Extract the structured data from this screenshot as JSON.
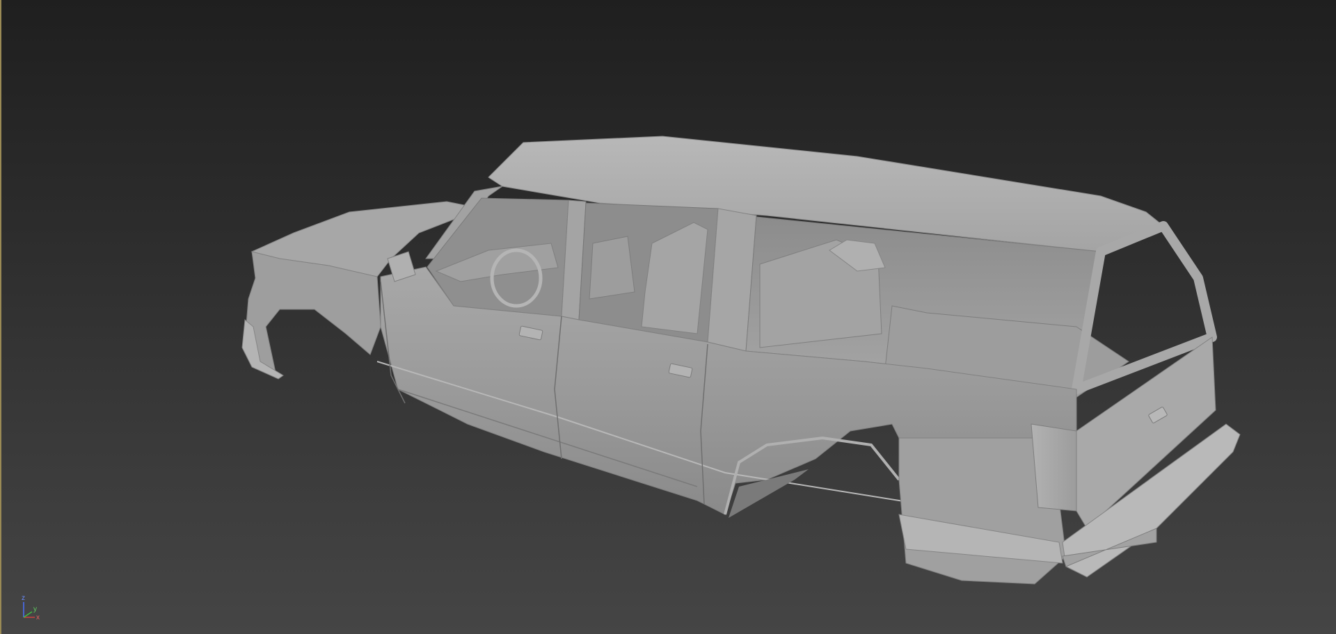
{
  "viewport": {
    "name": "3d-viewport-perspective",
    "background_top": "#1f1f1f",
    "background_bottom": "#454545",
    "border_color": "#9a8a55"
  },
  "model": {
    "shading_color": "#a9a9a9",
    "name": "suv-body-shell-model"
  },
  "axis_gizmo": {
    "x_label": "x",
    "y_label": "y",
    "z_label": "z",
    "x_color": "#d04040",
    "y_color": "#40c040",
    "z_color": "#4a70ff"
  }
}
